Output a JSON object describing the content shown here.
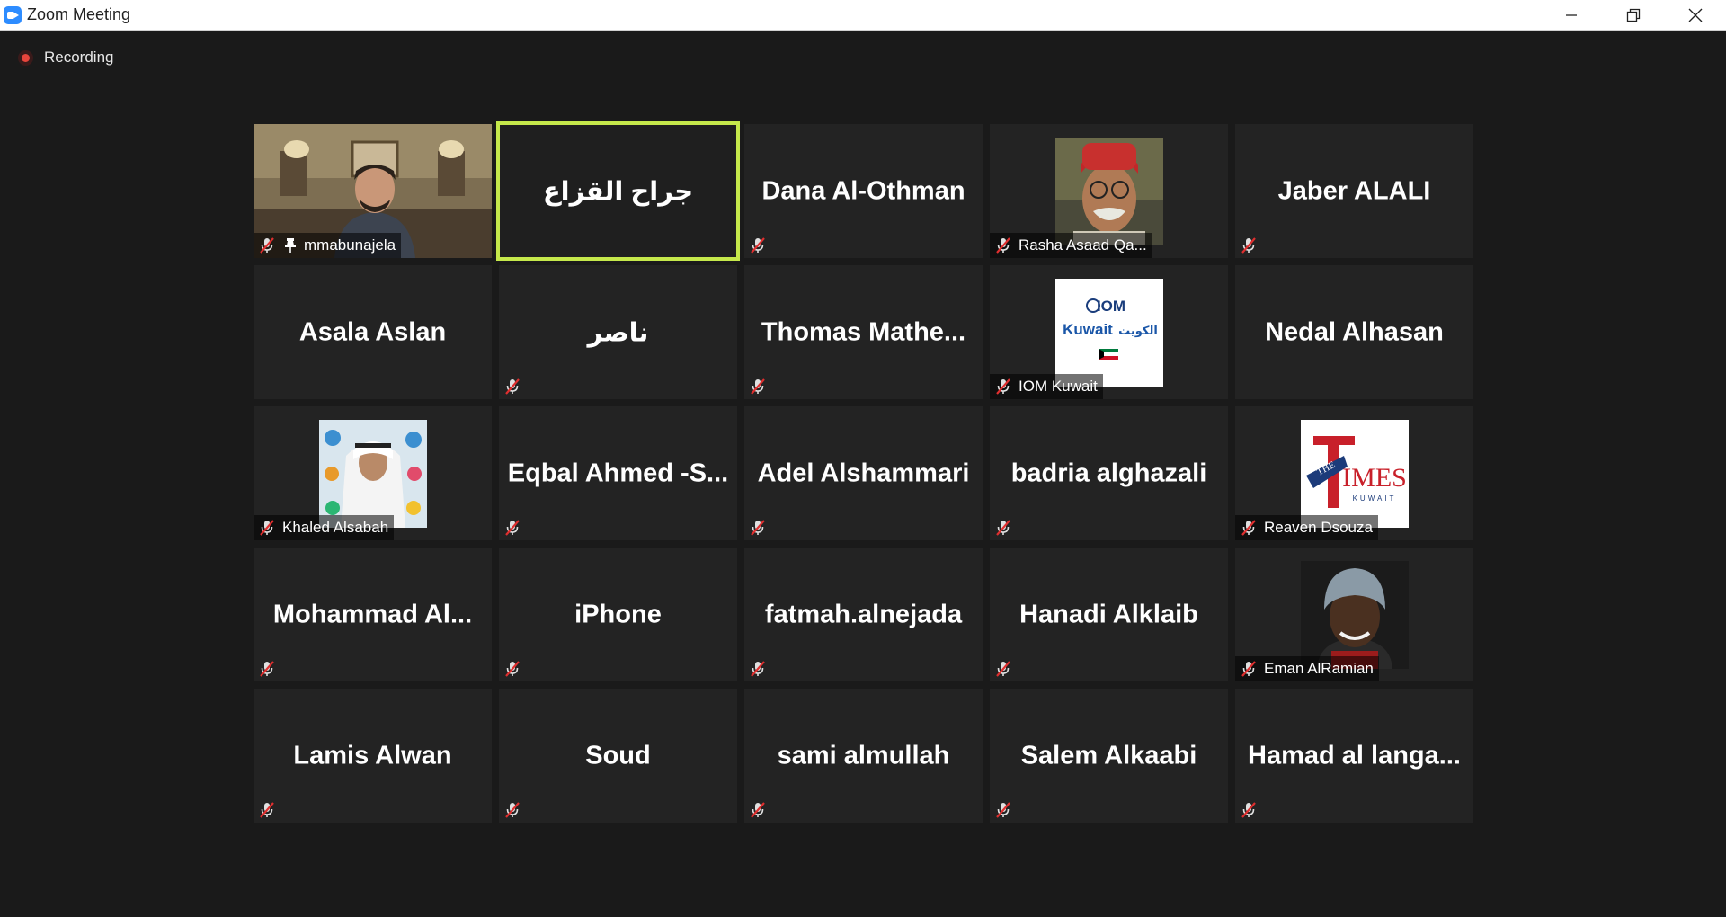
{
  "window": {
    "title": "Zoom Meeting",
    "controls": {
      "minimize": "minimize-icon",
      "restore": "restore-icon",
      "close": "close-icon"
    }
  },
  "recording": {
    "label": "Recording",
    "color": "#e8453c"
  },
  "colors": {
    "active_speaker_border": "#c5e84b",
    "tile_bg": "#232323",
    "stage_bg": "#1a1a1a"
  },
  "tiles": [
    {
      "name": "",
      "label": "mmabunajela",
      "muted": true,
      "pinned": true,
      "kind": "video"
    },
    {
      "name": "جراح القزاع",
      "label": "",
      "muted": false,
      "active": true,
      "kind": "name"
    },
    {
      "name": "Dana Al-Othman",
      "label": "",
      "muted": true,
      "kind": "name"
    },
    {
      "name": "",
      "label": "Rasha Asaad Qa...",
      "muted": true,
      "kind": "avatar-man"
    },
    {
      "name": "Jaber ALALI",
      "label": "",
      "muted": true,
      "kind": "name"
    },
    {
      "name": "Asala Aslan",
      "label": "",
      "muted": false,
      "kind": "name"
    },
    {
      "name": "ناصر",
      "label": "",
      "muted": true,
      "kind": "name"
    },
    {
      "name": "Thomas  Mathe...",
      "label": "",
      "muted": true,
      "kind": "name"
    },
    {
      "name": "",
      "label": "IOM Kuwait",
      "muted": true,
      "kind": "avatar-iom",
      "logo_text": [
        "IOM",
        "Kuwait",
        "الكويت"
      ]
    },
    {
      "name": "Nedal Alhasan",
      "label": "",
      "muted": false,
      "kind": "name"
    },
    {
      "name": "",
      "label": "Khaled Alsabah",
      "muted": true,
      "kind": "avatar-khaled"
    },
    {
      "name": "Eqbal  Ahmed  -S...",
      "label": "",
      "muted": true,
      "kind": "name"
    },
    {
      "name": "Adel Alshammari",
      "label": "",
      "muted": true,
      "kind": "name"
    },
    {
      "name": "badria alghazali",
      "label": "",
      "muted": true,
      "kind": "name"
    },
    {
      "name": "",
      "label": "Reaven Dsouza",
      "muted": true,
      "kind": "avatar-times",
      "logo_text": [
        "THE",
        "IMES",
        "KUWAIT"
      ]
    },
    {
      "name": "Mohammad  Al...",
      "label": "",
      "muted": true,
      "kind": "name"
    },
    {
      "name": "iPhone",
      "label": "",
      "muted": true,
      "kind": "name"
    },
    {
      "name": "fatmah.alnejada",
      "label": "",
      "muted": true,
      "kind": "name"
    },
    {
      "name": "Hanadi Alklaib",
      "label": "",
      "muted": true,
      "kind": "name"
    },
    {
      "name": "",
      "label": "Eman AlRamian",
      "muted": true,
      "kind": "avatar-woman"
    },
    {
      "name": "Lamis Alwan",
      "label": "",
      "muted": true,
      "kind": "name"
    },
    {
      "name": "Soud",
      "label": "",
      "muted": true,
      "kind": "name"
    },
    {
      "name": "sami almullah",
      "label": "",
      "muted": true,
      "kind": "name"
    },
    {
      "name": "Salem Alkaabi",
      "label": "",
      "muted": true,
      "kind": "name"
    },
    {
      "name": "Hamad  al  langa...",
      "label": "",
      "muted": true,
      "kind": "name"
    }
  ]
}
